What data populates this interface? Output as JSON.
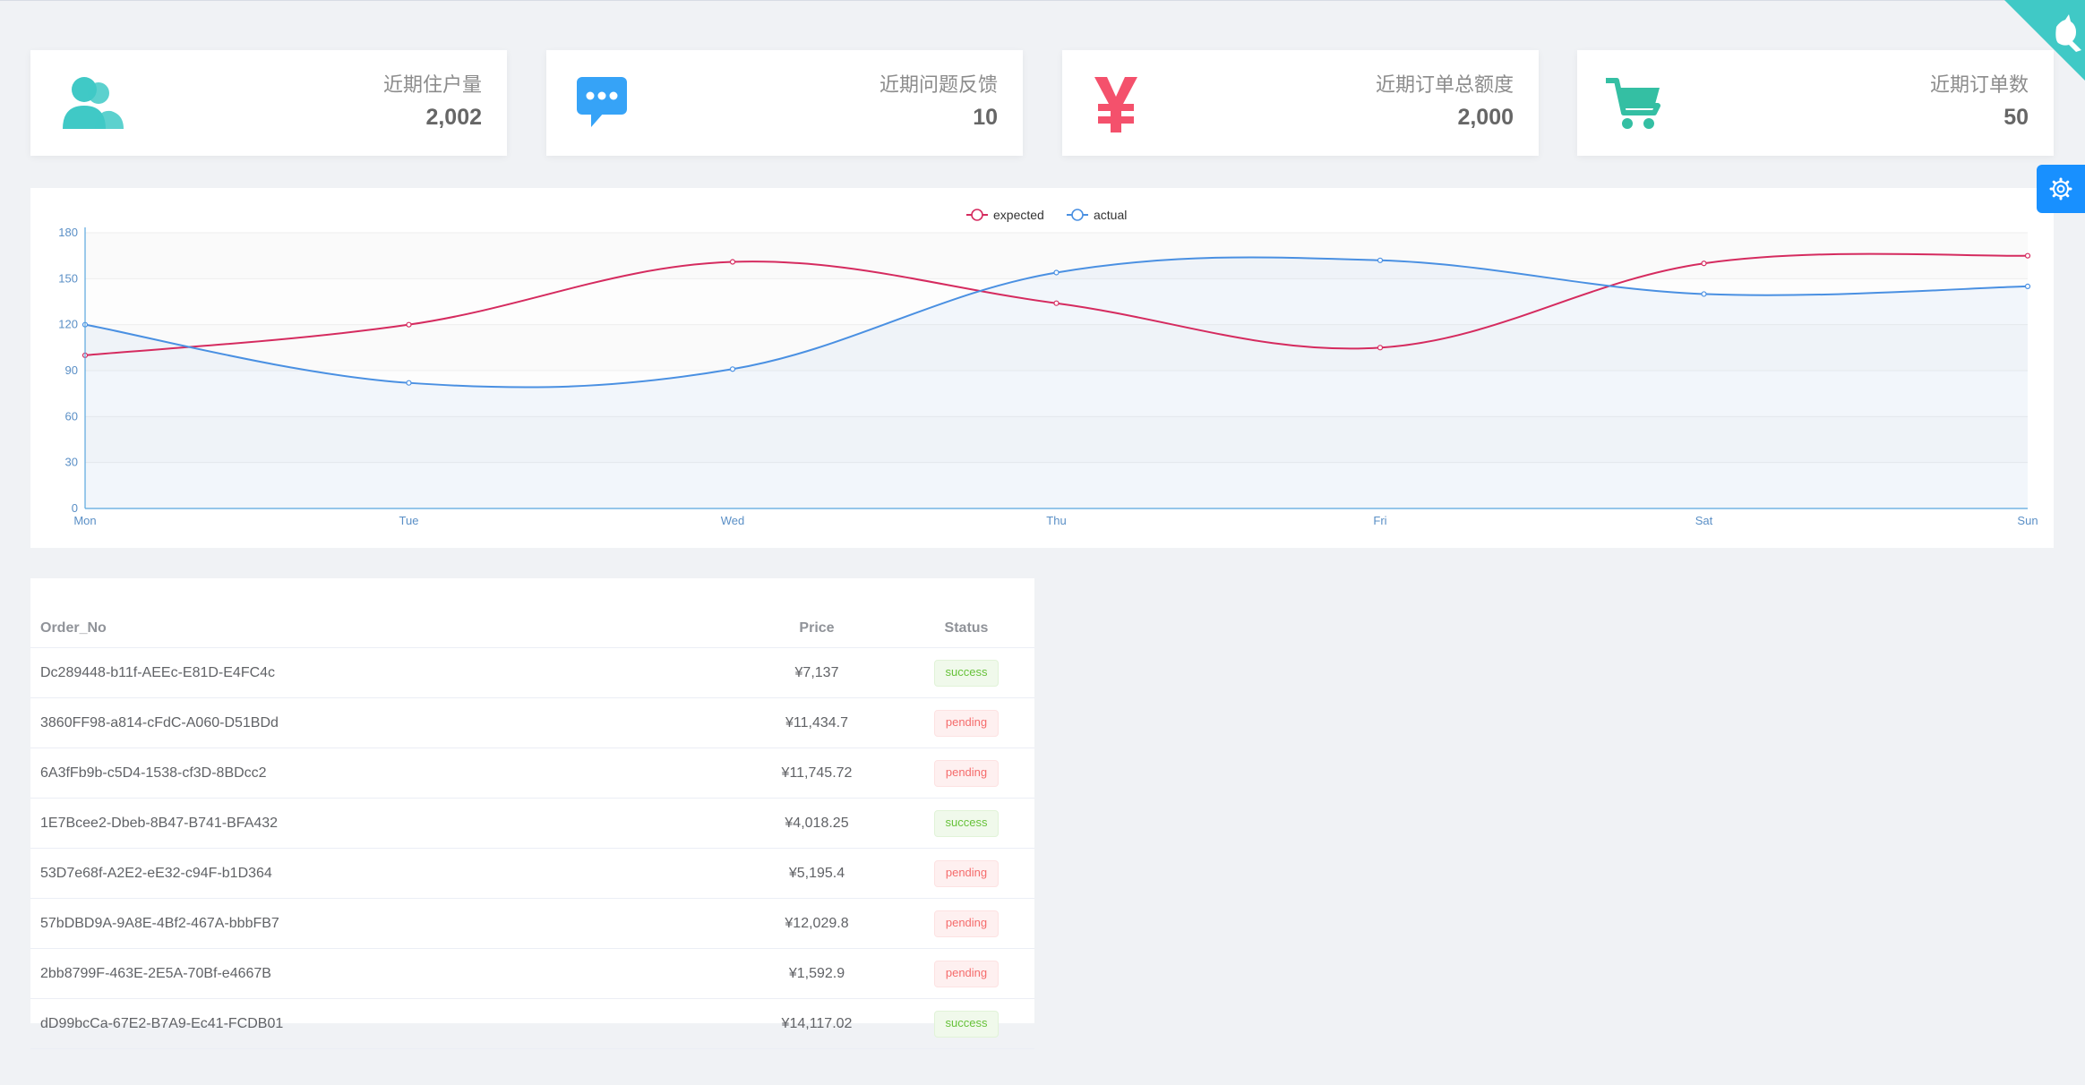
{
  "cards": [
    {
      "label": "近期住户量",
      "value": "2,002",
      "icon": "users-icon",
      "color": "#40c9c6"
    },
    {
      "label": "近期问题反馈",
      "value": "10",
      "icon": "message-icon",
      "color": "#36a3f7"
    },
    {
      "label": "近期订单总额度",
      "value": "2,000",
      "icon": "yen-icon",
      "color": "#f4516c"
    },
    {
      "label": "近期订单数",
      "value": "50",
      "icon": "shopping-cart-icon",
      "color": "#34bfa3"
    }
  ],
  "chart_data": {
    "type": "line",
    "categories": [
      "Mon",
      "Tue",
      "Wed",
      "Thu",
      "Fri",
      "Sat",
      "Sun"
    ],
    "series": [
      {
        "name": "expected",
        "values": [
          100,
          120,
          161,
          134,
          105,
          160,
          165
        ],
        "color": "#d52b5f"
      },
      {
        "name": "actual",
        "values": [
          120,
          82,
          91,
          154,
          162,
          140,
          145
        ],
        "color": "#4a90e2"
      }
    ],
    "yticks": [
      "0",
      "30",
      "60",
      "90",
      "120",
      "150",
      "180"
    ],
    "ylim": [
      0,
      180
    ],
    "legend": "top-center",
    "grid": true
  },
  "table": {
    "headers": [
      "Order_No",
      "Price",
      "Status"
    ],
    "rows": [
      {
        "order_no": "Dc289448-b11f-AEEc-E81D-E4FC4c",
        "price": "¥7,137",
        "status": "success"
      },
      {
        "order_no": "3860FF98-a814-cFdC-A060-D51BDd",
        "price": "¥11,434.7",
        "status": "pending"
      },
      {
        "order_no": "6A3fFb9b-c5D4-1538-cf3D-8BDcc2",
        "price": "¥11,745.72",
        "status": "pending"
      },
      {
        "order_no": "1E7Bcee2-Dbeb-8B47-B741-BFA432",
        "price": "¥4,018.25",
        "status": "success"
      },
      {
        "order_no": "53D7e68f-A2E2-eE32-c94F-b1D364",
        "price": "¥5,195.4",
        "status": "pending"
      },
      {
        "order_no": "57bDBD9A-9A8E-4Bf2-467A-bbbFB7",
        "price": "¥12,029.8",
        "status": "pending"
      },
      {
        "order_no": "2bb8799F-463E-2E5A-70Bf-e4667B",
        "price": "¥1,592.9",
        "status": "pending"
      },
      {
        "order_no": "dD99bcCa-67E2-B7A9-Ec41-FCDB01",
        "price": "¥14,117.02",
        "status": "success"
      }
    ]
  },
  "corner": {
    "icon": "github-cat-icon",
    "color": "#40c9c6"
  },
  "settings": {
    "icon": "gear-icon",
    "color": "#1890ff"
  }
}
